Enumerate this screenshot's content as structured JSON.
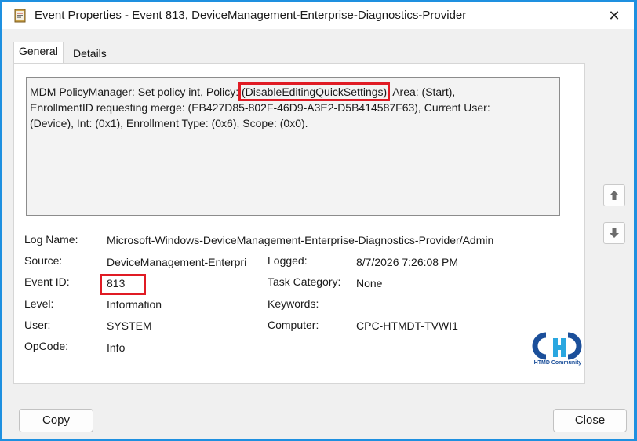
{
  "window": {
    "title": "Event Properties - Event 813, DeviceManagement-Enterprise-Diagnostics-Provider",
    "close_glyph": "✕"
  },
  "tabs": [
    {
      "label": "General",
      "selected": true
    },
    {
      "label": "Details",
      "selected": false
    }
  ],
  "description": {
    "line1_pre": "MDM PolicyManager: Set policy int, Policy: ",
    "line1_highlight": "(DisableEditingQuickSettings)",
    "line1_post": ", Area: (Start),",
    "line2": "EnrollmentID requesting merge: (EB427D85-802F-46D9-A3E2-D5B414587F63), Current User:",
    "line3": "(Device), Int: (0x1), Enrollment Type: (0x6), Scope: (0x0)."
  },
  "fields": {
    "log_name_label": "Log Name:",
    "log_name_value": "Microsoft-Windows-DeviceManagement-Enterprise-Diagnostics-Provider/Admin",
    "source_label": "Source:",
    "source_value": "DeviceManagement-Enterpri",
    "logged_label": "Logged:",
    "logged_value": "8/7/2026 7:26:08 PM",
    "event_id_label": "Event ID:",
    "event_id_value": "813",
    "task_category_label": "Task Category:",
    "task_category_value": "None",
    "level_label": "Level:",
    "level_value": "Information",
    "keywords_label": "Keywords:",
    "keywords_value": "",
    "user_label": "User:",
    "user_value": "SYSTEM",
    "computer_label": "Computer:",
    "computer_value": "CPC-HTMDT-TVWI1",
    "opcode_label": "OpCode:",
    "opcode_value": "Info"
  },
  "watermark": {
    "text": "HTMD Community",
    "color_primary": "#1b4f9a",
    "color_accent": "#2aa7e0"
  },
  "buttons": {
    "copy_label": "Copy",
    "close_label": "Close"
  },
  "icons": {
    "app": "event-viewer-icon",
    "close": "close-icon",
    "up": "arrow-up-icon",
    "down": "arrow-down-icon"
  },
  "colors": {
    "highlight": "#e01b24",
    "border_frame": "#1e90e0"
  }
}
